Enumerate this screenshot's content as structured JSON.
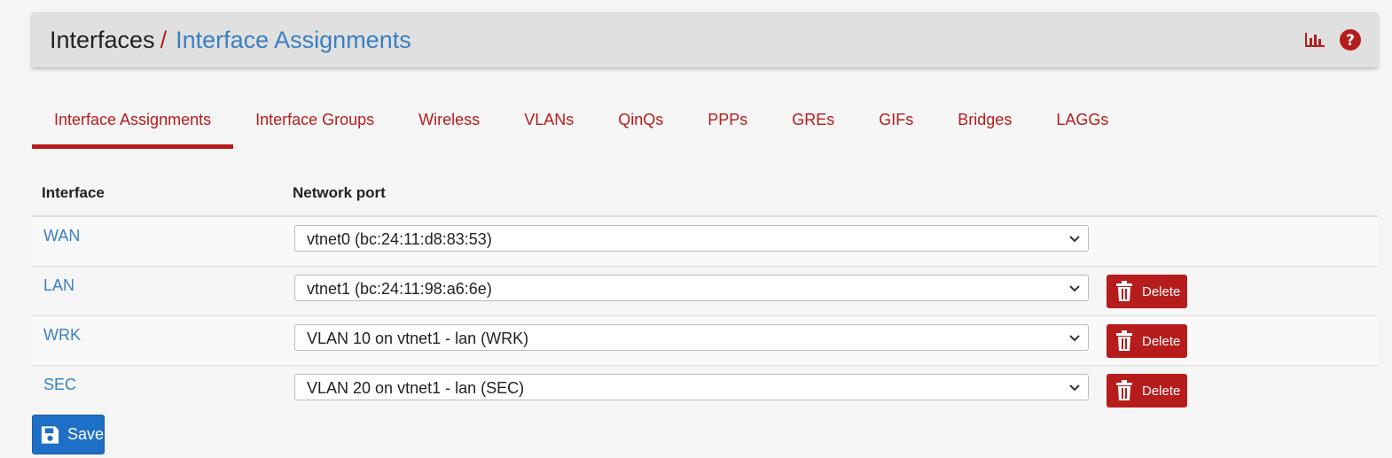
{
  "breadcrumb": {
    "root": "Interfaces",
    "separator": "/",
    "current": "Interface Assignments"
  },
  "header_icons": [
    "bar-chart-icon",
    "help-icon"
  ],
  "tabs": [
    {
      "label": "Interface Assignments",
      "active": true
    },
    {
      "label": "Interface Groups",
      "active": false
    },
    {
      "label": "Wireless",
      "active": false
    },
    {
      "label": "VLANs",
      "active": false
    },
    {
      "label": "QinQs",
      "active": false
    },
    {
      "label": "PPPs",
      "active": false
    },
    {
      "label": "GREs",
      "active": false
    },
    {
      "label": "GIFs",
      "active": false
    },
    {
      "label": "Bridges",
      "active": false
    },
    {
      "label": "LAGGs",
      "active": false
    }
  ],
  "table": {
    "columns": [
      "Interface",
      "Network port"
    ],
    "rows": [
      {
        "interface": "WAN",
        "port": "vtnet0 (bc:24:11:d8:83:53)",
        "deletable": false
      },
      {
        "interface": "LAN",
        "port": "vtnet1 (bc:24:11:98:a6:6e)",
        "deletable": true
      },
      {
        "interface": "WRK",
        "port": "VLAN 10 on vtnet1 - lan (WRK)",
        "deletable": true
      },
      {
        "interface": "SEC",
        "port": "VLAN 20 on vtnet1 - lan (SEC)",
        "deletable": true
      }
    ],
    "delete_label": "Delete"
  },
  "save_label": "Save",
  "colors": {
    "accent_red": "#b71c1c",
    "link_blue": "#3a7fc1",
    "save_blue": "#1e6fc6"
  }
}
